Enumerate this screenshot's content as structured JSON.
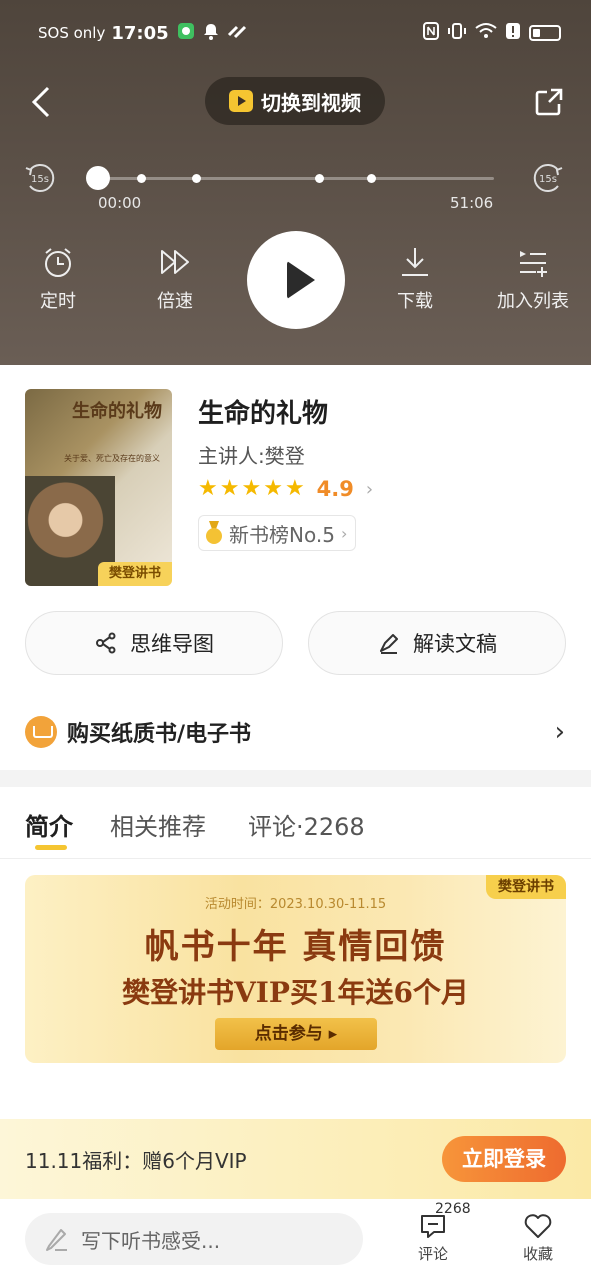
{
  "status": {
    "carrier": "SOS only",
    "time": "17:05"
  },
  "player": {
    "switch_label": "切换到视频",
    "skip_back": "15s",
    "skip_forward": "15s",
    "time_start": "00:00",
    "time_end": "51:06",
    "progress": 0.0,
    "controls": {
      "timer": "定时",
      "speed": "倍速",
      "download": "下载",
      "add_list": "加入列表"
    }
  },
  "book": {
    "title": "生命的礼物",
    "speaker": "主讲人:樊登",
    "rating": "4.9",
    "stars": 5,
    "rank_label": "新书榜No.5",
    "cover_title": "生命的礼物",
    "cover_subtitle": "关于爱、死亡及存在的意义",
    "cover_tag": "樊登讲书"
  },
  "actions": {
    "mindmap": "思维导图",
    "transcript": "解读文稿"
  },
  "buy": {
    "label": "购买纸质书/电子书"
  },
  "tabs": [
    {
      "label": "简介"
    },
    {
      "label": "相关推荐"
    },
    {
      "label": "评论·2268"
    }
  ],
  "banner": {
    "corner": "樊登讲书",
    "date": "活动时间：2023.10.30-11.15",
    "headline": "帆书十年 真情回馈",
    "subline": "樊登讲书VIP买1年送6个月",
    "cta": "点击参与 ▸"
  },
  "promo": {
    "text": "11.11福利：赠6个月VIP",
    "login": "立即登录"
  },
  "bottom": {
    "placeholder": "写下听书感受...",
    "comment_count": "2268",
    "comment_label": "评论",
    "favorite_label": "收藏"
  },
  "colors": {
    "accent": "#f5c531",
    "orange": "#f08c28",
    "login": "#ee6b2f"
  }
}
